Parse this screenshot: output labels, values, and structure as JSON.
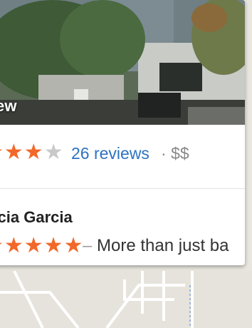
{
  "card": {
    "photo_label": "ew",
    "rating_stars": "★★★",
    "rating_empty_star": "★",
    "reviews_link": "26 reviews",
    "price_separator": "·",
    "price": "$$",
    "reviewer_name": "rcia Garcia",
    "review_stars": "★★★★★",
    "review_dash": "–",
    "review_text": "More than just ba"
  },
  "colors": {
    "star": "#f2682a",
    "empty_star": "#c9c9c9",
    "link": "#2e72c2",
    "muted": "#888888"
  }
}
